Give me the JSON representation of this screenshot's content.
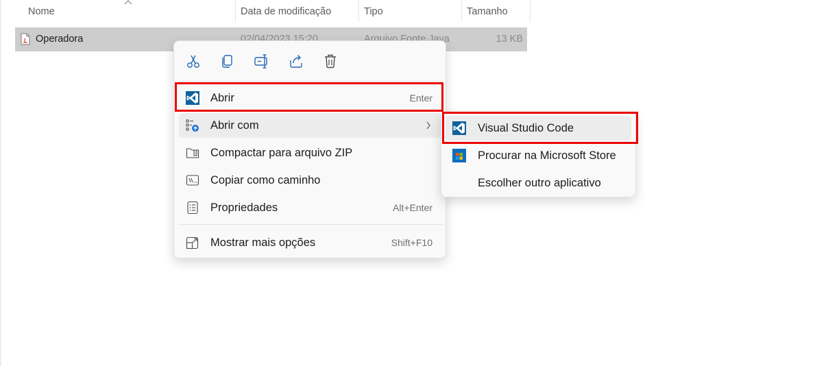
{
  "columns": {
    "name": "Nome",
    "date": "Data de modificação",
    "type": "Tipo",
    "size": "Tamanho"
  },
  "file": {
    "name": "Operadora",
    "date": "02/04/2023 15:20",
    "type": "Arquivo Fonte Java",
    "size": "13 KB",
    "icon": "java-file-icon"
  },
  "context_menu": {
    "quick_actions": [
      {
        "name": "cut",
        "icon": "scissors-icon"
      },
      {
        "name": "copy",
        "icon": "copy-icon"
      },
      {
        "name": "rename",
        "icon": "rename-icon"
      },
      {
        "name": "share",
        "icon": "share-icon"
      },
      {
        "name": "delete",
        "icon": "trash-icon"
      }
    ],
    "items": [
      {
        "label": "Abrir",
        "shortcut": "Enter",
        "icon": "vscode-icon"
      },
      {
        "label": "Abrir com",
        "shortcut": "",
        "icon": "open-with-icon"
      },
      {
        "label": "Compactar para arquivo ZIP",
        "shortcut": "",
        "icon": "zip-icon"
      },
      {
        "label": "Copiar como caminho",
        "shortcut": "",
        "icon": "copy-path-icon"
      },
      {
        "label": "Propriedades",
        "shortcut": "Alt+Enter",
        "icon": "properties-icon"
      },
      {
        "label": "Mostrar mais opções",
        "shortcut": "Shift+F10",
        "icon": "more-options-icon"
      }
    ]
  },
  "submenu": {
    "items": [
      {
        "label": "Visual Studio Code",
        "icon": "vscode-icon"
      },
      {
        "label": "Procurar na Microsoft Store",
        "icon": "microsoft-store-icon"
      },
      {
        "label": "Escolher outro aplicativo",
        "icon": ""
      }
    ]
  },
  "colors": {
    "highlight": "#ec0000",
    "vscode_blue": "#0e639c",
    "accent": "#0067c0"
  }
}
